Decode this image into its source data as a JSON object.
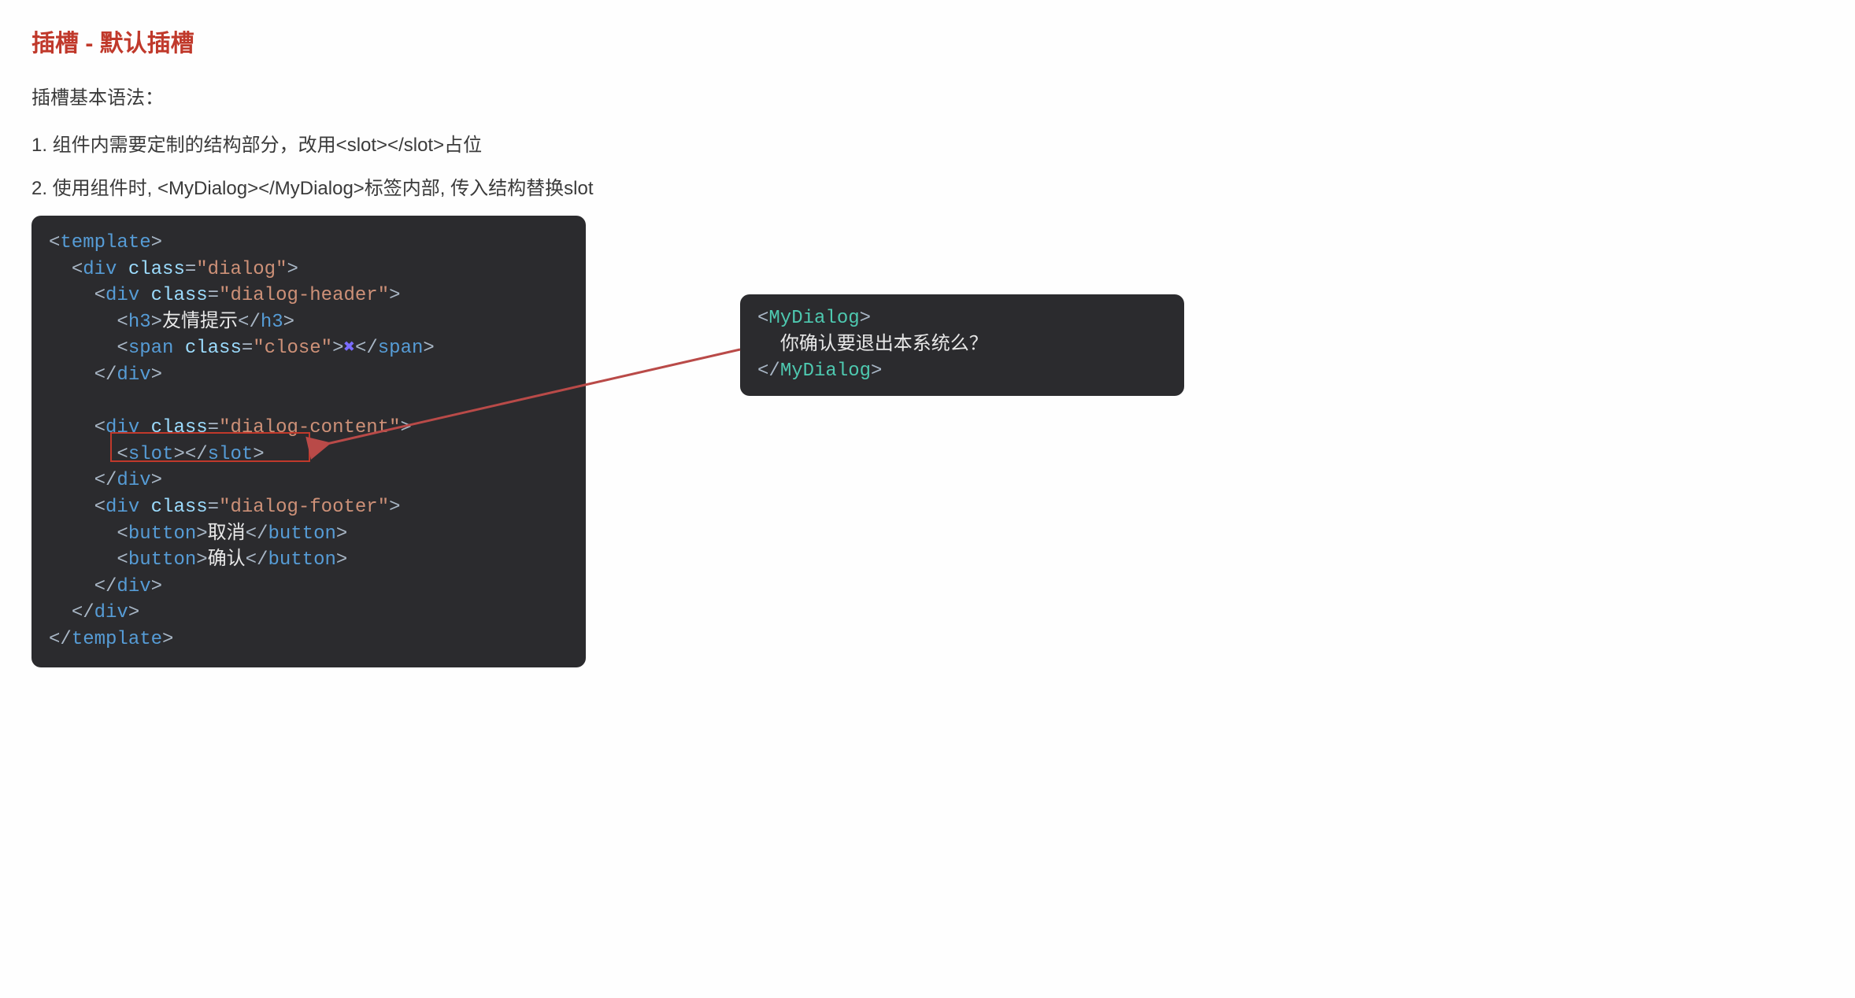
{
  "heading": "插槽 - 默认插槽",
  "subtitle": "插槽基本语法：",
  "list1": "1. 组件内需要定制的结构部分，改用<slot></slot>占位",
  "list2": "2. 使用组件时, <MyDialog></MyDialog>标签内部, 传入结构替换slot",
  "code_left": {
    "template_open": "template",
    "div": "div",
    "class_attr": "class",
    "eq": "=",
    "dialog": "\"dialog\"",
    "dialog_header": "\"dialog-header\"",
    "h3": "h3",
    "h3_text": "友情提示",
    "span": "span",
    "close": "\"close\"",
    "x": "✖",
    "dialog_content": "\"dialog-content\"",
    "slot": "slot",
    "dialog_footer": "\"dialog-footer\"",
    "button": "button",
    "cancel": "取消",
    "confirm": "确认"
  },
  "code_right": {
    "mydialog": "MyDialog",
    "content": "你确认要退出本系统么？"
  }
}
